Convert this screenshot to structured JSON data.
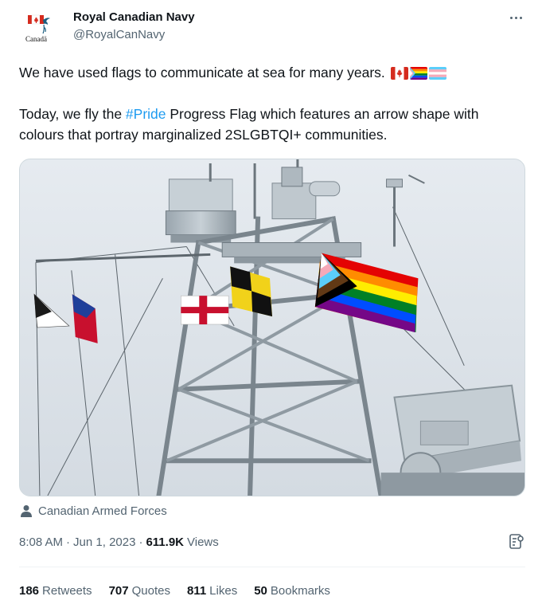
{
  "account": {
    "display_name": "Royal Canadian Navy",
    "handle": "@RoyalCanNavy",
    "avatar_text": "Canadä"
  },
  "tweet": {
    "line1": "We have used flags to communicate at sea for many years.",
    "line2_prefix": "Today, we fly the ",
    "hashtag": "#Pride",
    "line2_suffix": " Progress Flag which features an arrow shape with colours that portray marginalized 2SLGBTQI+ communities.",
    "emojis": [
      "canada-flag-emoji",
      "progress-pride-flag-emoji",
      "transgender-flag-emoji"
    ]
  },
  "media": {
    "credit": "Canadian Armed Forces"
  },
  "meta": {
    "time": "8:08 AM",
    "date": "Jun 1, 2023",
    "views_count": "611.9K",
    "views_label": "Views"
  },
  "stats": {
    "retweets_count": "186",
    "retweets_label": "Retweets",
    "quotes_count": "707",
    "quotes_label": "Quotes",
    "likes_count": "811",
    "likes_label": "Likes",
    "bookmarks_count": "50",
    "bookmarks_label": "Bookmarks"
  },
  "colors": {
    "link": "#1d9bf0",
    "text": "#0f1419",
    "secondary": "#536471",
    "border": "#eff3f4"
  }
}
